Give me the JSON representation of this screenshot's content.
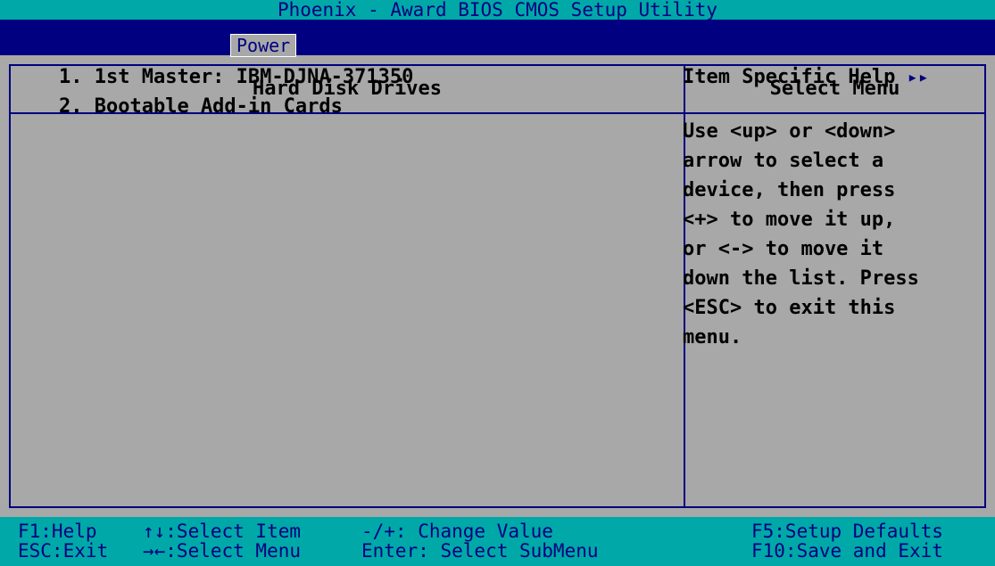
{
  "title": "Phoenix - Award BIOS CMOS Setup Utility",
  "menu": {
    "active_tab": "Power"
  },
  "panel": {
    "left_header": "Hard Disk Drives",
    "right_header": "Select Menu",
    "items": [
      "1. 1st Master: IBM-DJNA-371350",
      "2. Bootable Add-in Cards"
    ],
    "help_title": "Item Specific Help",
    "help_arrows": "▸▸",
    "help_lines": [
      "Use <up> or <down>",
      "arrow to select a",
      "device, then press",
      "<+> to move it up,",
      "or <-> to move it",
      "down the list. Press",
      "<ESC> to exit this",
      "menu."
    ]
  },
  "footer": {
    "f1": "F1:Help",
    "esc": "ESC:Exit",
    "select_item": "↑↓:Select Item",
    "select_menu": "→←:Select Menu",
    "change_value": "-/+: Change Value",
    "enter": "Enter: Select SubMenu",
    "f5": "F5:Setup Defaults",
    "f10": "F10:Save and Exit"
  },
  "colors": {
    "background": "#a8a8a8",
    "title_bar": "#00a8a8",
    "menu_bar": "#000080",
    "border": "#000080",
    "footer": "#00a8a8"
  }
}
